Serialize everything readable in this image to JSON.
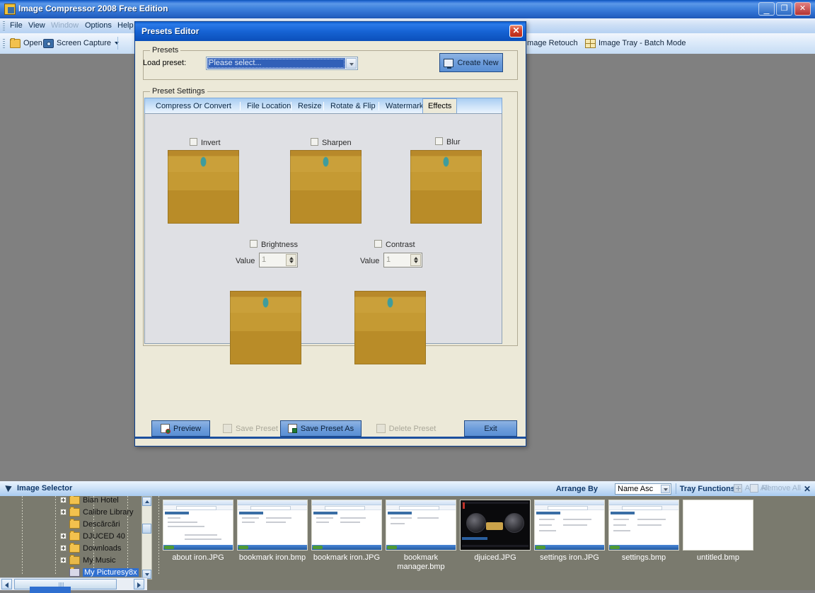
{
  "main_window": {
    "title": "Image Compressor 2008 Free Edition",
    "icon": "app-icon",
    "window_buttons": {
      "minimize": "_",
      "maximize": "❐",
      "close": "✕"
    },
    "menu": [
      {
        "label": "File",
        "disabled": false
      },
      {
        "label": "View",
        "disabled": false
      },
      {
        "label": "Window",
        "disabled": true
      },
      {
        "label": "Options",
        "disabled": false
      },
      {
        "label": "Help",
        "disabled": false
      }
    ],
    "toolbar": [
      {
        "label": "Open",
        "icon": "folder-icon",
        "dropdown": false
      },
      {
        "label": "Screen Capture",
        "icon": "camera-icon",
        "dropdown": true
      },
      {
        "label": "Image Retouch",
        "icon": "retouch-icon",
        "dropdown": false
      },
      {
        "label": "Image Tray - Batch Mode",
        "icon": "tray-icon",
        "dropdown": false
      }
    ]
  },
  "dialog": {
    "title": "Presets Editor",
    "close_label": "✕",
    "presets_group": {
      "title": "Presets",
      "load_preset_label": "Load preset:",
      "combo_value": "Please select...",
      "combo_placeholder": "Please select...",
      "create_new_label": "Create New"
    },
    "preset_settings_group": {
      "title": "Preset Settings",
      "tabs": [
        {
          "label": "Compress Or Convert",
          "active": false
        },
        {
          "label": "File Location",
          "active": false
        },
        {
          "label": "Resize",
          "active": false
        },
        {
          "label": "Rotate & Flip",
          "active": false
        },
        {
          "label": "Watermark",
          "active": false
        },
        {
          "label": "Effects",
          "active": true
        }
      ],
      "effects": {
        "top_row": [
          {
            "label": "Invert",
            "checked": false
          },
          {
            "label": "Sharpen",
            "checked": false
          },
          {
            "label": "Blur",
            "checked": false
          }
        ],
        "bottom_row": [
          {
            "label": "Brightness",
            "checked": false,
            "value_label": "Value",
            "value": "1"
          },
          {
            "label": "Contrast",
            "checked": false,
            "value_label": "Value",
            "value": "1"
          }
        ]
      }
    },
    "buttons": [
      {
        "label": "Preview",
        "enabled": true,
        "icon": "preview-icon"
      },
      {
        "label": "Save Preset",
        "enabled": false,
        "icon": "save-icon"
      },
      {
        "label": "Save Preset As",
        "enabled": true,
        "icon": "save-as-icon"
      },
      {
        "label": "Delete Preset",
        "enabled": false,
        "icon": "delete-icon"
      },
      {
        "label": "Exit",
        "enabled": true,
        "icon": ""
      }
    ]
  },
  "image_selector": {
    "title": "Image Selector",
    "arrange_by_label": "Arrange By",
    "arrange_by_value": "Name Asc",
    "tray_functions_label": "Tray Functions",
    "add_all_label": "Add All",
    "remove_all_label": "Remove All",
    "close_label": "✕",
    "tree": [
      {
        "label": "Bian Hotel",
        "expander": true,
        "selected": false,
        "partial": true
      },
      {
        "label": "Calibre Library",
        "expander": true,
        "selected": false
      },
      {
        "label": "Descărcări",
        "expander": false,
        "selected": false
      },
      {
        "label": "DJUCED 40",
        "expander": true,
        "selected": false
      },
      {
        "label": "Downloads",
        "expander": true,
        "selected": false
      },
      {
        "label": "My Music",
        "expander": true,
        "selected": false
      },
      {
        "label": "My Picturesy8x",
        "expander": false,
        "selected": true
      }
    ],
    "thumbnails": [
      {
        "label": "about iron.JPG",
        "kind": "browser"
      },
      {
        "label": "bookmark iron.bmp",
        "kind": "browser"
      },
      {
        "label": "bookmark iron.JPG",
        "kind": "browser"
      },
      {
        "label": "bookmark manager.bmp",
        "kind": "browser"
      },
      {
        "label": "djuiced.JPG",
        "kind": "dj"
      },
      {
        "label": "settings iron.JPG",
        "kind": "browser"
      },
      {
        "label": "settings.bmp",
        "kind": "browser"
      },
      {
        "label": "untitled.bmp",
        "kind": "plain"
      }
    ]
  },
  "colors": {
    "title_blue": "#1663d4",
    "dialog_face": "#ece9d8",
    "mdi_gray": "#808080",
    "selector_bg": "#7a7a6e",
    "button_blue": "#6d9ddb",
    "accent_text": "#123a6b"
  }
}
